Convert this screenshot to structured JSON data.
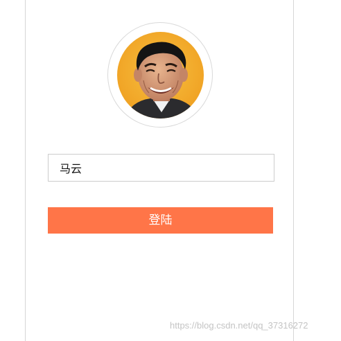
{
  "login_form": {
    "username_value": "马云",
    "login_button_label": "登陆"
  },
  "avatar": {
    "icon": "user-avatar-photo"
  },
  "watermark": {
    "text": "https://blog.csdn.net/qq_37316272"
  },
  "colors": {
    "accent": "#ff7548",
    "border": "#d6d6d6",
    "avatar_bg": "#f3a825"
  }
}
